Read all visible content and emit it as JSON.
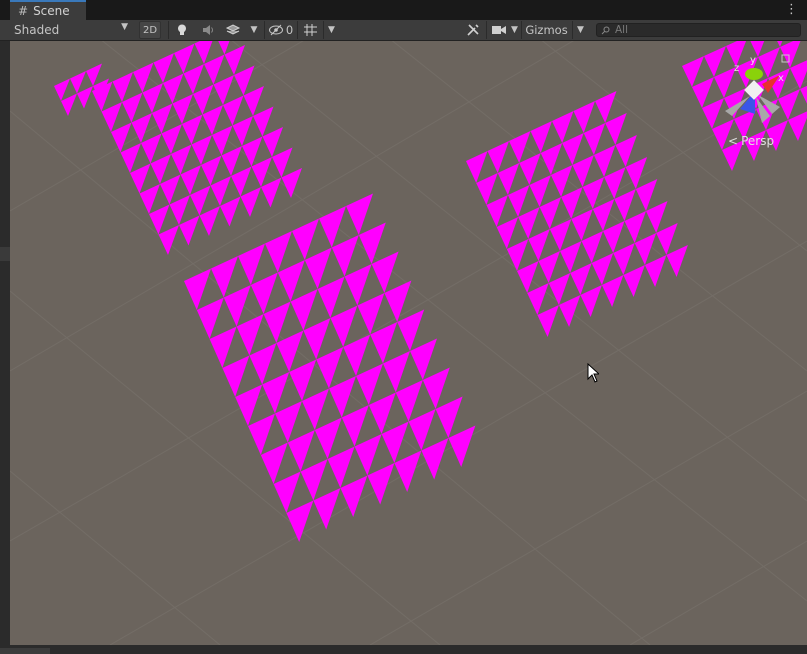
{
  "tab": {
    "title": "Scene",
    "icon": "grid-hash-icon"
  },
  "toolbar": {
    "draw_mode": "Shaded",
    "mode_2d": "2D",
    "hidden_count": "0",
    "gizmos_label": "Gizmos",
    "search_placeholder": "All"
  },
  "scene": {
    "projection_label": "Persp",
    "gizmo_axes": [
      "y",
      "z",
      "x"
    ],
    "mesh_color": "#ff00ff",
    "ground_color": "#6b645d"
  },
  "colors": {
    "tab_accent": "#3a79bb",
    "toolbar_bg": "#3c3c3c",
    "axis_x": "#e8312f",
    "axis_y": "#8ad20a",
    "axis_z": "#3a56e8"
  }
}
